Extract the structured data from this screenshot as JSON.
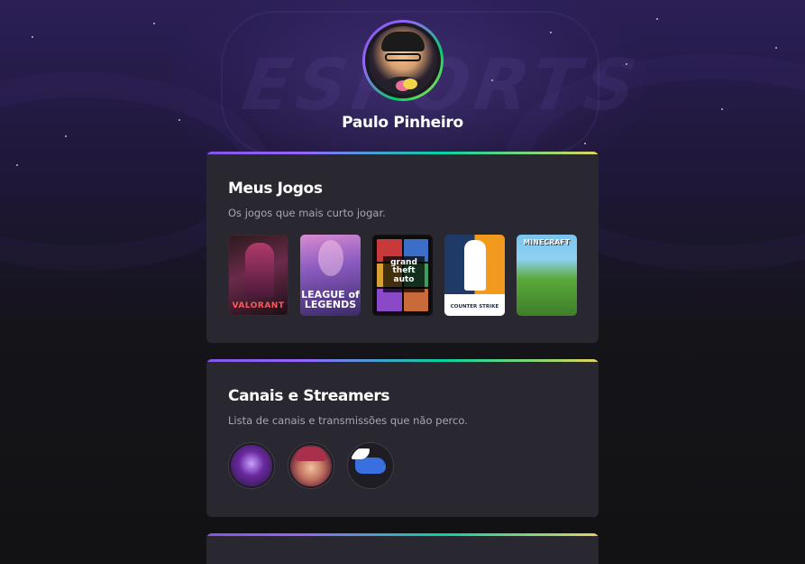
{
  "profile": {
    "name": "Paulo Pinheiro",
    "avatar_icon": "avatar-portrait"
  },
  "background": {
    "watermark_text": "ESPORTS"
  },
  "sections": {
    "games": {
      "title": "Meus Jogos",
      "description": "Os jogos que mais curto jogar.",
      "items": [
        {
          "name": "Valorant",
          "label": "VALORANT"
        },
        {
          "name": "League of Legends",
          "label": "LEAGUE of LEGENDS"
        },
        {
          "name": "Grand Theft Auto V",
          "label": "grand theft auto"
        },
        {
          "name": "Counter-Strike",
          "label": "COUNTER STRIKE"
        },
        {
          "name": "Minecraft",
          "label": "MINECRAFT"
        }
      ]
    },
    "channels": {
      "title": "Canais e Streamers",
      "description": "Lista de canais e transmissões que não perco.",
      "items": [
        {
          "name": "channel-1",
          "icon": "streamer-avatar"
        },
        {
          "name": "channel-2",
          "icon": "streamer-avatar"
        },
        {
          "name": "channel-3",
          "icon": "winged-shoe-logo"
        }
      ]
    }
  },
  "colors": {
    "background": "#121214",
    "card": "#29272f",
    "gradient_purple": "#8257e5",
    "gradient_green": "#04d361",
    "gradient_yellow": "#e1d55d",
    "text_muted": "#a8a8b3"
  }
}
